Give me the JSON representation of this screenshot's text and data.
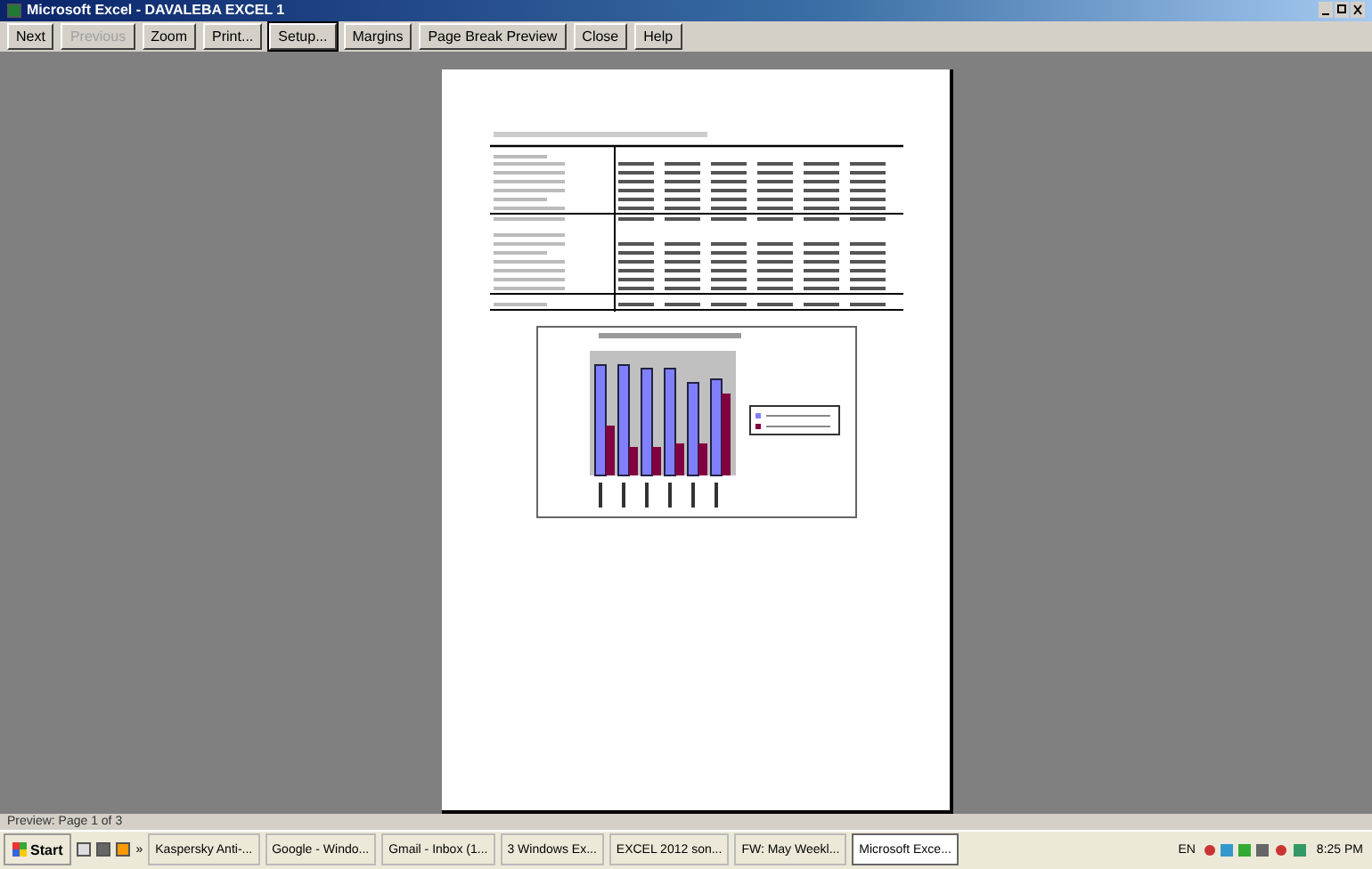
{
  "window": {
    "title": "Microsoft Excel - DAVALEBA EXCEL 1"
  },
  "toolbar": [
    {
      "label": "Next",
      "disabled": false,
      "focused": false
    },
    {
      "label": "Previous",
      "disabled": true,
      "focused": false
    },
    {
      "label": "Zoom",
      "disabled": false,
      "focused": false
    },
    {
      "label": "Print...",
      "disabled": false,
      "focused": false
    },
    {
      "label": "Setup...",
      "disabled": false,
      "focused": true
    },
    {
      "label": "Margins",
      "disabled": false,
      "focused": false
    },
    {
      "label": "Page Break Preview",
      "disabled": false,
      "focused": false
    },
    {
      "label": "Close",
      "disabled": false,
      "focused": false
    },
    {
      "label": "Help",
      "disabled": false,
      "focused": false
    }
  ],
  "status_bar": "Preview: Page 1 of 3",
  "taskbar": {
    "start": "Start",
    "more": "»",
    "tasks": [
      {
        "label": "Kaspersky Anti-...",
        "selected": false
      },
      {
        "label": "Google - Windo...",
        "selected": false
      },
      {
        "label": "Gmail - Inbox (1...",
        "selected": false
      },
      {
        "label": "3 Windows Ex...",
        "selected": false
      },
      {
        "label": "EXCEL 2012 son...",
        "selected": false
      },
      {
        "label": "FW: May Weekl...",
        "selected": false
      },
      {
        "label": "Microsoft Exce...",
        "selected": true
      }
    ],
    "language": "EN",
    "clock": "8:25 PM"
  }
}
